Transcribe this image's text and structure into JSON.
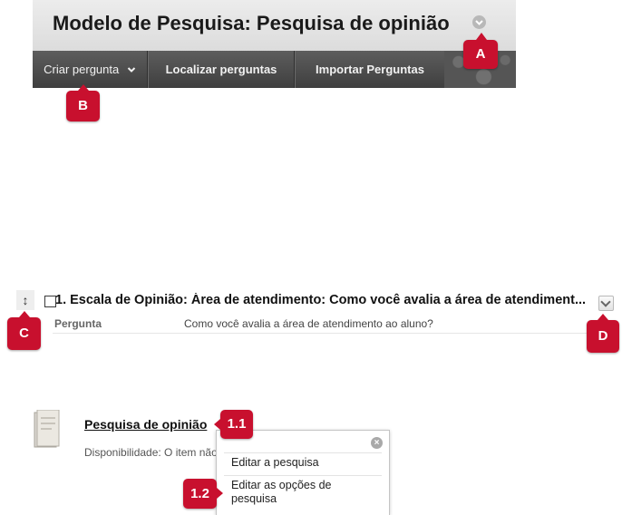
{
  "header": {
    "title": "Modelo de Pesquisa: Pesquisa de opinião",
    "title_menu_icon": "chevron-down-icon"
  },
  "toolbar": {
    "create_question": "Criar pergunta",
    "find_questions": "Localizar perguntas",
    "import_questions": "Importar Perguntas"
  },
  "callouts": {
    "a": "A",
    "b": "B",
    "c": "C",
    "d": "D",
    "c11": "1.1",
    "c12": "1.2",
    "color": "#c8102e"
  },
  "question": {
    "drag_handle_glyph": "↕",
    "title": "1. Escala de Opinião: Área de atendimento: Como você avalia a área de atendiment...",
    "label": "Pergunta",
    "value": "Como você avalia a área de atendimento ao aluno?"
  },
  "survey": {
    "link": "Pesquisa de opinião",
    "availability": "Disponibilidade:  O item não",
    "menu": {
      "close_glyph": "×",
      "edit_survey": "Editar a pesquisa",
      "edit_options": "Editar as opções de pesquisa"
    }
  }
}
